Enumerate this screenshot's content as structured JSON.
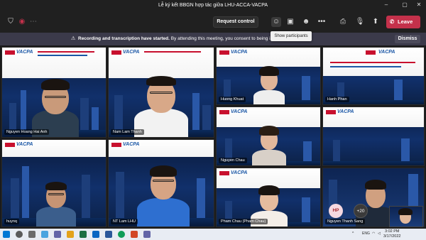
{
  "window": {
    "title": "Lễ ký kết BBGN hợp tác giữa LHU-ACCA-VACPA"
  },
  "toolbar": {
    "request_control_label": "Request control",
    "leave_label": "Leave",
    "accent": "#c4314b"
  },
  "tooltip": {
    "text": "Show participants"
  },
  "banner": {
    "bold_text": "Recording and transcription have started.",
    "text": "By attending this meeting, you consent to being i",
    "dismiss_label": "Dismiss"
  },
  "participants": [
    {
      "name": "Nguyen Hoang Hai Anh"
    },
    {
      "name": "Nam Lam Thanh"
    },
    {
      "name": "Huong Khuat"
    },
    {
      "name": "Hanh Phan"
    },
    {
      "name": "Nguyen Chau"
    },
    {
      "name": "huynq"
    },
    {
      "name": "NT Lam LHU"
    },
    {
      "name": "Pham Chau (Pham Chau)"
    },
    {
      "name": "Nguyen Thanh Sang"
    }
  ],
  "overflow": {
    "avatar_initials": "HP",
    "more_count": "+20"
  },
  "slide": {
    "logo_text": "VACPA"
  },
  "taskbar": {
    "language": "ENG",
    "time": "3:02 PM",
    "date": "3/17/2022"
  }
}
